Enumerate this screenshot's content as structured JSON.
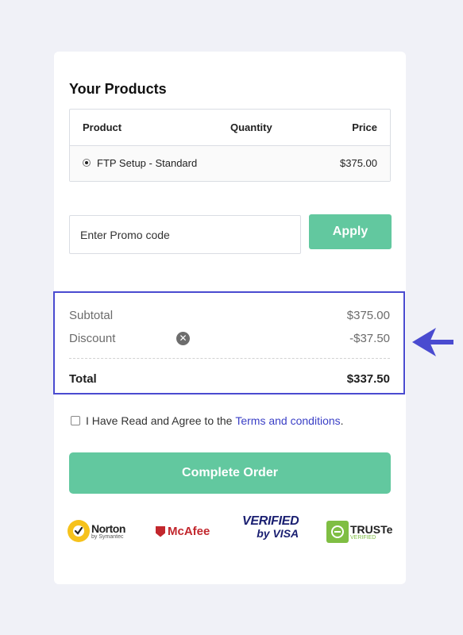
{
  "products": {
    "title": "Your Products",
    "headers": {
      "product": "Product",
      "quantity": "Quantity",
      "price": "Price"
    },
    "rows": [
      {
        "name": "FTP Setup - Standard",
        "price": "$375.00",
        "selected": true
      }
    ]
  },
  "promo": {
    "placeholder": "Enter Promo code",
    "apply_label": "Apply"
  },
  "summary": {
    "subtotal_label": "Subtotal",
    "subtotal_value": "$375.00",
    "discount_label": "Discount",
    "discount_value": "-$37.50",
    "total_label": "Total",
    "total_value": "$337.50",
    "highlight_color": "#4a4bd0"
  },
  "agreement": {
    "text": "I Have Read and Agree to the",
    "link": "Terms and conditions",
    "end": "."
  },
  "complete_label": "Complete Order",
  "trust_badges": {
    "norton": {
      "name": "Norton",
      "sub": "by Symantec"
    },
    "mcafee": {
      "name": "McAfee"
    },
    "visa": {
      "top": "VERIFIED",
      "bottom": "by VISA"
    },
    "truste": {
      "name": "TRUSTe",
      "sub": "VERIFIED"
    }
  },
  "colors": {
    "accent_green": "#62c89f",
    "link_blue": "#3a3fc6",
    "arrow_blue": "#4a4bd0"
  }
}
